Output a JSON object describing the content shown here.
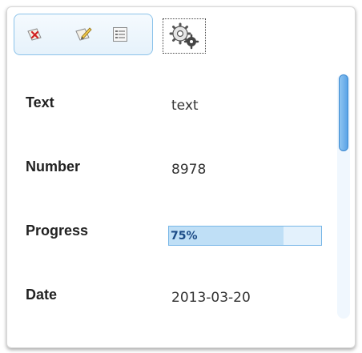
{
  "toolbar": {
    "buttons": [
      {
        "name": "delete-record-button",
        "icon": "card-delete-icon"
      },
      {
        "name": "edit-record-button",
        "icon": "card-edit-icon"
      },
      {
        "name": "view-details-button",
        "icon": "list-view-icon"
      }
    ],
    "settings": {
      "icon": "gears-icon"
    }
  },
  "fields": [
    {
      "label": "Text",
      "value": "text"
    },
    {
      "label": "Number",
      "value": "8978"
    },
    {
      "label": "Progress",
      "value": "75%",
      "progress": 0.75
    },
    {
      "label": "Date",
      "value": "2013-03-20"
    }
  ],
  "colors": {
    "accent": "#8cc3ea",
    "scroll_thumb": "#5aa3e6",
    "progress_fill": "#bfdff6"
  }
}
